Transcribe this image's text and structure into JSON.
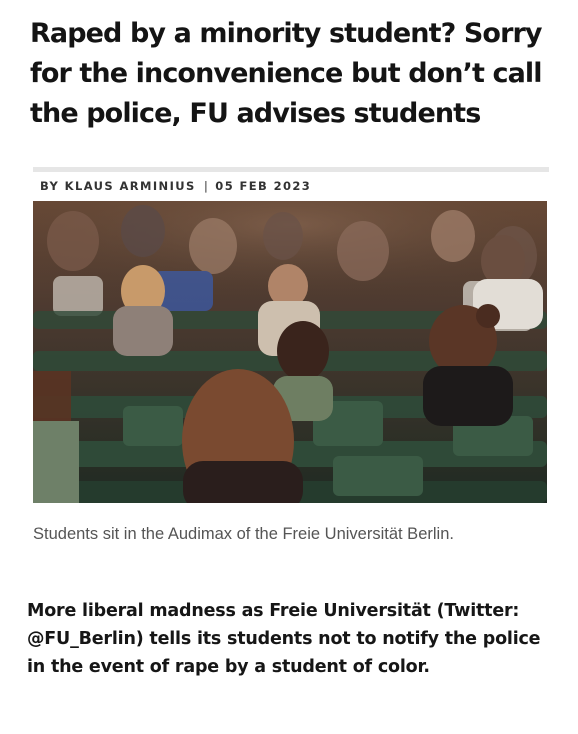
{
  "article": {
    "headline": "Raped by a minority student? Sorry for the inconvenience but don’t call the police, FU advises students",
    "byline": {
      "author": "BY KLAUS ARMINIUS",
      "separator": "|",
      "date": "05 FEB 2023"
    },
    "photo_caption": "Students sit in the Audimax of the Freie Universität Berlin.",
    "summary": "More liberal madness as Freie Universität (Twitter: @FU_Berlin) tells its students not to notify the police in the event of rape by a student of color."
  },
  "colors": {
    "headline": "#141414",
    "byline": "#333333",
    "caption": "#555555",
    "rule": "#e6e6e6",
    "seat_green": "#2f4a38"
  }
}
